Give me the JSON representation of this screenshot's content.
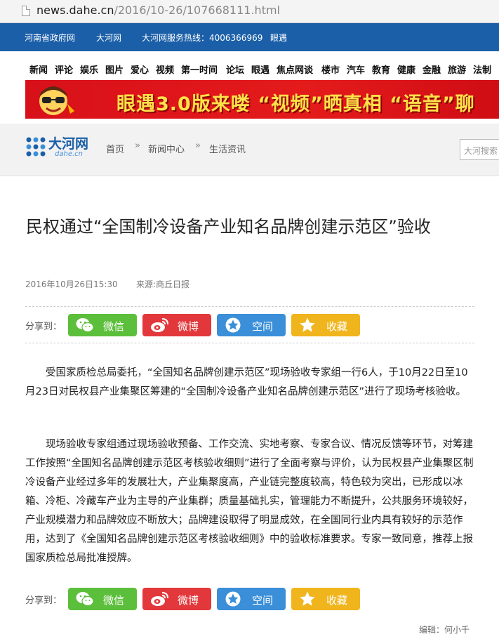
{
  "browser": {
    "url_host": "news.dahe.cn",
    "url_path": "/2016/10-26/107668111.html"
  },
  "topbar": {
    "items": [
      "河南省政府网",
      "大河网",
      "大河网服务热线：4006366969",
      "眼遇"
    ]
  },
  "nav": {
    "items": [
      "新闻",
      "评论",
      "娱乐",
      "图片",
      "爱心",
      "视频",
      "第一时间",
      "论坛",
      "眼遇",
      "焦点网谈",
      "楼市",
      "汽车",
      "教育",
      "健康",
      "金融",
      "旅游",
      "法制"
    ]
  },
  "banner": {
    "text": "眼遇3.0版来喽 “视频”晒真相 “语音”聊"
  },
  "header": {
    "logo_text": "大河网",
    "logo_sub": "dahe.cn",
    "breadcrumb": [
      "首页",
      "新闻中心",
      "生活资讯"
    ],
    "search_placeholder": "大河搜索"
  },
  "article": {
    "title": "民权通过“全国制冷设备产业知名品牌创建示范区”验收",
    "date": "2016年10月26日15:30",
    "source": "来源:商丘日报",
    "paragraphs": [
      "受国家质检总局委托，“全国知名品牌创建示范区”现场验收专家组一行6人，于10月22日至10月23日对民权县产业集聚区筹建的“全国制冷设备产业知名品牌创建示范区”进行了现场考核验收。",
      "现场验收专家组通过现场验收预备、工作交流、实地考察、专家合议、情况反馈等环节，对筹建工作按照“全国知名品牌创建示范区考核验收细则”进行了全面考察与评价，认为民权县产业集聚区制冷设备产业经过多年的发展壮大，产业集聚度高，产业链完整度较高，特色较为突出，已形成以冰箱、冷柜、冷藏车产业为主导的产业集群；质量基础扎实，管理能力不断提升，公共服务环境较好，产业规模潜力和品牌效应不断放大；品牌建设取得了明显成效，在全国同行业内具有较好的示范作用，达到了《全国知名品牌创建示范区考核验收细则》中的验收标准要求。专家一致同意，推荐上报国家质检总局批准授牌。"
    ],
    "editor": "编辑：何小千"
  },
  "share": {
    "label": "分享到：",
    "buttons": [
      "微信",
      "微博",
      "空间",
      "收藏"
    ]
  },
  "colors": {
    "topbar": "#1b5fa8",
    "banner": "#e41b1b",
    "wechat": "#5cbf3b",
    "weibo": "#e2383c",
    "qzone": "#3a8fd8",
    "favorite": "#f0b41c"
  }
}
